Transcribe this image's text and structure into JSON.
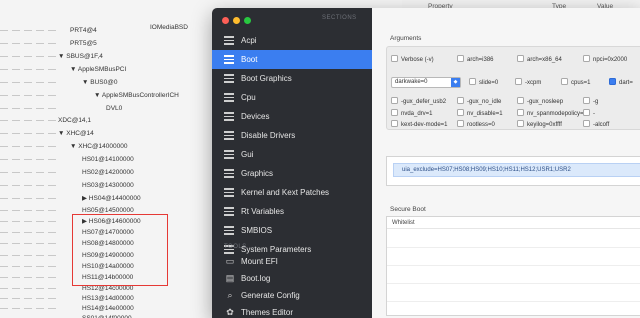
{
  "background": {
    "tree_rows": [
      {
        "label": "PRT4@4",
        "indent": 1
      },
      {
        "label": "PRT5@5",
        "indent": 1
      },
      {
        "label": "▼ SBUS@1F,4",
        "indent": 0
      },
      {
        "label": "▼ AppleSMBusPCI",
        "indent": 1
      },
      {
        "label": "▼ BUS0@0",
        "indent": 2
      },
      {
        "label": "▼ AppleSMBusControllerICH",
        "indent": 3
      },
      {
        "label": "DVL0",
        "indent": 4
      },
      {
        "label": "XDC@14,1",
        "indent": 0
      },
      {
        "label": "▼ XHC@14",
        "indent": 0
      },
      {
        "label": "▼ XHC@14000000",
        "indent": 1
      },
      {
        "label": "HS01@14100000",
        "indent": 2
      },
      {
        "label": "HS02@14200000",
        "indent": 2
      },
      {
        "label": "HS03@14300000",
        "indent": 2
      },
      {
        "label": "▶ HS04@14400000",
        "indent": 2
      },
      {
        "label": "HS05@14500000",
        "indent": 2
      },
      {
        "label": "▶ HS06@14600000",
        "indent": 2
      },
      {
        "label": "HS07@14700000",
        "indent": 2
      },
      {
        "label": "HS08@14800000",
        "indent": 2
      },
      {
        "label": "HS09@14900000",
        "indent": 2
      },
      {
        "label": "HS10@14a00000",
        "indent": 2
      },
      {
        "label": "HS11@14b00000",
        "indent": 2
      },
      {
        "label": "HS12@14c00000",
        "indent": 2
      },
      {
        "label": "HS13@14d00000",
        "indent": 2
      },
      {
        "label": "HS14@14e00000",
        "indent": 2
      },
      {
        "label": "SS01@14f00000",
        "indent": 2
      }
    ],
    "top_item": "IOMediaBSD",
    "columns": {
      "property": "Property",
      "type": "Type",
      "value": "Value"
    }
  },
  "sidebar": {
    "sections_title": "SECTIONS",
    "items": [
      {
        "label": "Acpi",
        "selected": false
      },
      {
        "label": "Boot",
        "selected": true
      },
      {
        "label": "Boot Graphics",
        "selected": false
      },
      {
        "label": "Cpu",
        "selected": false
      },
      {
        "label": "Devices",
        "selected": false
      },
      {
        "label": "Disable Drivers",
        "selected": false
      },
      {
        "label": "Gui",
        "selected": false
      },
      {
        "label": "Graphics",
        "selected": false
      },
      {
        "label": "Kernel and Kext Patches",
        "selected": false
      },
      {
        "label": "Rt Variables",
        "selected": false
      },
      {
        "label": "SMBIOS",
        "selected": false
      },
      {
        "label": "System Parameters",
        "selected": false
      }
    ],
    "tools_title": "TOOLS",
    "tools": [
      {
        "label": "Mount EFI",
        "icon": "drive-icon"
      },
      {
        "label": "Boot.log",
        "icon": "log-icon"
      },
      {
        "label": "Generate Config",
        "icon": "magnifier-icon"
      },
      {
        "label": "Themes Editor",
        "icon": "palette-icon"
      }
    ]
  },
  "main": {
    "arguments_title": "Arguments",
    "args": [
      {
        "label": "Verbose (-v)",
        "checked": false
      },
      {
        "label": "arch=i386",
        "checked": false
      },
      {
        "label": "arch=x86_64",
        "checked": false
      },
      {
        "label": "npci=0x2000",
        "checked": false
      },
      {
        "label": "slide=0",
        "checked": false
      },
      {
        "label": "-xcpm",
        "checked": false
      },
      {
        "label": "cpus=1",
        "checked": false
      },
      {
        "label": "dart=",
        "checked": true
      },
      {
        "label": "-gux_defer_usb2",
        "checked": false
      },
      {
        "label": "-gux_no_idle",
        "checked": false
      },
      {
        "label": "-gux_nosleep",
        "checked": false
      },
      {
        "label": "-g",
        "checked": false
      },
      {
        "label": "nvda_drv=1",
        "checked": false
      },
      {
        "label": "nv_disable=1",
        "checked": false
      },
      {
        "label": "nv_spanmodepolicy=1",
        "checked": false
      },
      {
        "label": "-",
        "checked": false
      },
      {
        "label": "kext-dev-mode=1",
        "checked": false
      },
      {
        "label": "rootless=0",
        "checked": false
      },
      {
        "label": "keyilog=0xffff",
        "checked": false
      },
      {
        "label": "-alcoff",
        "checked": false
      }
    ],
    "darkwake_value": "darkwake=0",
    "custom_args": "uia_exclude=HS07;HS08;HS09;HS10;HS11;HS12;USR1;USR2",
    "secure_boot_title": "Secure Boot",
    "whitelist_header": "Whitelist"
  }
}
